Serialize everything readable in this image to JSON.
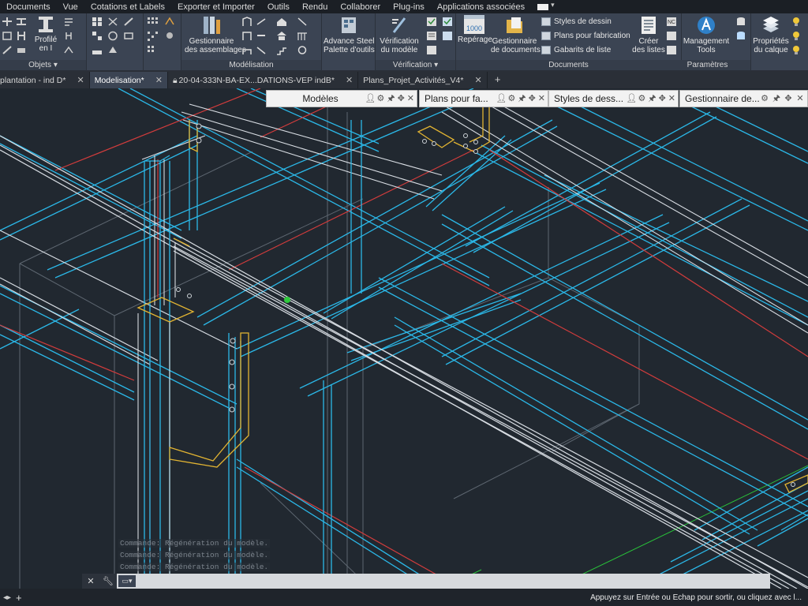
{
  "menubar": {
    "items": [
      "Documents",
      "Vue",
      "Cotations et Labels",
      "Exporter et Importer",
      "Outils",
      "Rendu",
      "Collaborer",
      "Plug-ins",
      "Applications associées"
    ]
  },
  "ribbon": {
    "panels": {
      "objets": {
        "label": "Objets ▾",
        "profile_label": "Profilé\nen I"
      },
      "modelisation": {
        "label": "Modélisation",
        "assembly_label": "Gestionnaire\ndes assemblages"
      },
      "advance": {
        "label": "Advance Steel\nPalette d'outils"
      },
      "verification": {
        "label": "Vérification ▾",
        "verify_label": "Vérification\ndu modèle"
      },
      "documents": {
        "label": "Documents",
        "reperage_label": "Repérage",
        "reperage_value": "1000",
        "gestionnaire_label": "Gestionnaire\nde documents",
        "styles_label": "Styles de dessin",
        "plans_label": "Plans pour fabrication",
        "gabarits_label": "Gabarits de liste",
        "creer_label": "Créer\ndes listes"
      },
      "parametres": {
        "label": "Paramètres",
        "management_label": "Management\nTools"
      },
      "calque": {
        "properties_label": "Propriétés\ndu calque"
      }
    }
  },
  "tabs": [
    {
      "label": "plantation - ind D*",
      "active": false
    },
    {
      "label": "Modelisation*",
      "active": true
    },
    {
      "label": "20-04-333N-BA-EX...DATIONS-VEP indB*",
      "active": false,
      "locked": true
    },
    {
      "label": "Plans_Projet_Activités_V4*",
      "active": false
    }
  ],
  "palettes": [
    {
      "title": "Modèles"
    },
    {
      "title": "Plans pour fa..."
    },
    {
      "title": "Styles de dess..."
    },
    {
      "title": "Gestionnaire de..."
    }
  ],
  "command_history": [
    "Commande:  Régénération du modèle.",
    "Commande:  Régénération du modèle.",
    "Commande:  Régénération du modèle."
  ],
  "command_line": {
    "value": ""
  },
  "status": {
    "prompt": "Appuyez sur Entrée ou Echap pour sortir, ou cliquez avec l..."
  },
  "colors": {
    "background": "#212830",
    "beam_cyan": "#2bb8e8",
    "beam_white": "#d8dde3",
    "beam_red": "#d23c3c",
    "plate_yellow": "#e2b432",
    "grid_green": "#29c23a",
    "ribbon": "#3b4453"
  }
}
